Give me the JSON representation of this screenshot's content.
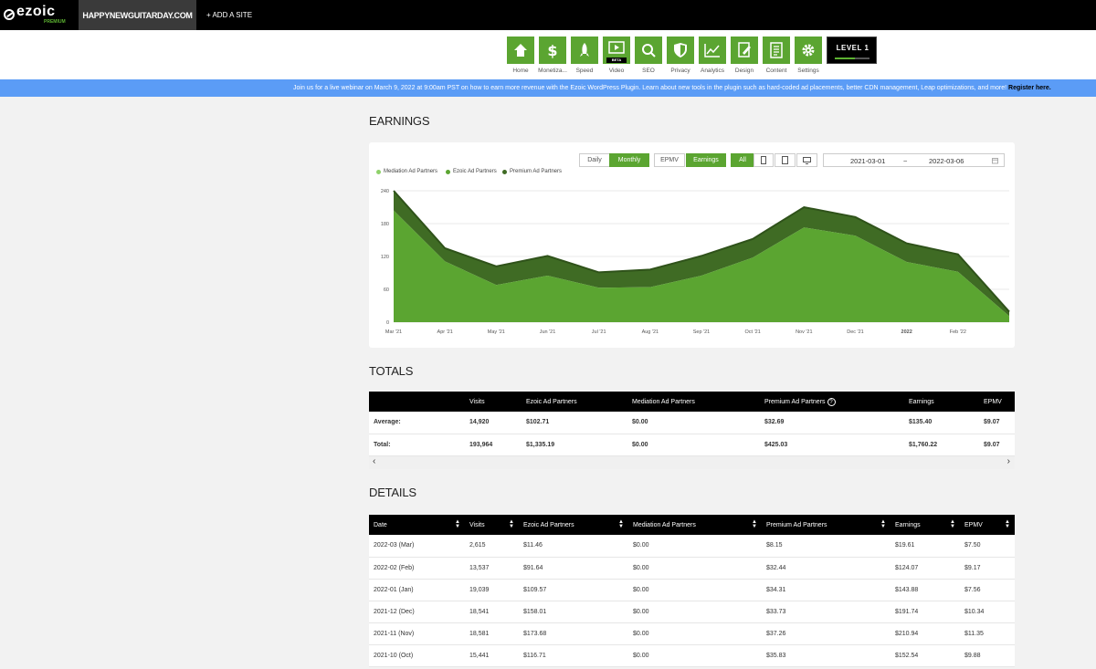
{
  "topbar": {
    "logo": "ezoic",
    "logo_sub": "PREMIUM",
    "site": "HAPPYNEWGUITARDAY.COM",
    "add_site": "+ ADD A SITE"
  },
  "nav": {
    "items": [
      {
        "label": "Home",
        "icon": "home-icon"
      },
      {
        "label": "Monetiza...",
        "icon": "dollar-icon"
      },
      {
        "label": "Speed",
        "icon": "rocket-icon"
      },
      {
        "label": "Video",
        "icon": "video-icon"
      },
      {
        "label": "SEO",
        "icon": "search-icon"
      },
      {
        "label": "Privacy",
        "icon": "shield-icon"
      },
      {
        "label": "Analytics",
        "icon": "chart-icon"
      },
      {
        "label": "Design",
        "icon": "design-icon"
      },
      {
        "label": "Content",
        "icon": "document-icon"
      },
      {
        "label": "Settings",
        "icon": "gear-icon"
      }
    ],
    "video_badge": "BETA",
    "level": "LEVEL 1"
  },
  "banner": {
    "text": "Join us for a live webinar on March 9, 2022 at 9:00am PST on how to earn more revenue with the Ezoic WordPress Plugin. Learn about new tools in the plugin such as hard-coded ad placements, better CDN management, Leap optimizations, and more!",
    "link": "Register here."
  },
  "earnings": {
    "title": "EARNINGS",
    "controls": {
      "daily": "Daily",
      "monthly": "Monthly",
      "epmv": "EPMV",
      "earnings": "Earnings",
      "all": "All"
    },
    "date_from": "2021-03-01",
    "date_sep": "~",
    "date_to": "2022-03-06"
  },
  "chart_data": {
    "type": "area",
    "categories": [
      "Mar '21",
      "Apr '21",
      "May '21",
      "Jun '21",
      "Jul '21",
      "Aug '21",
      "Sep '21",
      "Oct '21",
      "Nov '21",
      "Dec '21",
      "2022",
      "Feb '22"
    ],
    "x": [
      "Mar '21",
      "Apr '21",
      "May '21",
      "Jun '21",
      "Jul '21",
      "Aug '21",
      "Sep '21",
      "Oct '21",
      "Nov '21",
      "Dec '21",
      "2022",
      "Feb '22",
      "Mar '22"
    ],
    "series": [
      {
        "name": "Mediation Ad Partners",
        "color": "#8fd16a",
        "values": [
          0,
          0,
          0,
          0,
          0,
          0,
          0,
          0,
          0,
          0,
          0,
          0,
          0
        ]
      },
      {
        "name": "Ezoic Ad Partners",
        "color": "#5ba531",
        "values": [
          204,
          111,
          68,
          85,
          63,
          64,
          85,
          118,
          173,
          158,
          110,
          92,
          11
        ]
      },
      {
        "name": "Premium Ad Partners",
        "color": "#3f6b24",
        "values": [
          36,
          24,
          34,
          36,
          28,
          32,
          36,
          34,
          37,
          34,
          34,
          32,
          8
        ]
      }
    ],
    "ylim": [
      0,
      240
    ],
    "yticks": [
      0,
      60,
      120,
      180,
      240
    ],
    "legend_position": "top-left",
    "stacked": true,
    "grid": true
  },
  "totals": {
    "title": "TOTALS",
    "columns": [
      "",
      "Visits",
      "Ezoic Ad Partners",
      "Mediation Ad Partners",
      "Premium Ad Partners",
      "Earnings",
      "EPMV"
    ],
    "rows": [
      [
        "Average:",
        "14,920",
        "$102.71",
        "$0.00",
        "$32.69",
        "$135.40",
        "$9.07"
      ],
      [
        "Total:",
        "193,964",
        "$1,335.19",
        "$0.00",
        "$425.03",
        "$1,760.22",
        "$9.07"
      ]
    ]
  },
  "details": {
    "title": "DETAILS",
    "columns": [
      "Date",
      "Visits",
      "Ezoic Ad Partners",
      "Mediation Ad Partners",
      "Premium Ad Partners",
      "Earnings",
      "EPMV"
    ],
    "rows": [
      [
        "2022-03 (Mar)",
        "2,615",
        "$11.46",
        "$0.00",
        "$8.15",
        "$19.61",
        "$7.50"
      ],
      [
        "2022-02 (Feb)",
        "13,537",
        "$91.64",
        "$0.00",
        "$32.44",
        "$124.07",
        "$9.17"
      ],
      [
        "2022-01 (Jan)",
        "19,039",
        "$109.57",
        "$0.00",
        "$34.31",
        "$143.88",
        "$7.56"
      ],
      [
        "2021-12 (Dec)",
        "18,541",
        "$158.01",
        "$0.00",
        "$33.73",
        "$191.74",
        "$10.34"
      ],
      [
        "2021-11 (Nov)",
        "18,581",
        "$173.68",
        "$0.00",
        "$37.26",
        "$210.94",
        "$11.35"
      ],
      [
        "2021-10 (Oct)",
        "15,441",
        "$116.71",
        "$0.00",
        "$35.83",
        "$152.54",
        "$9.88"
      ]
    ]
  }
}
